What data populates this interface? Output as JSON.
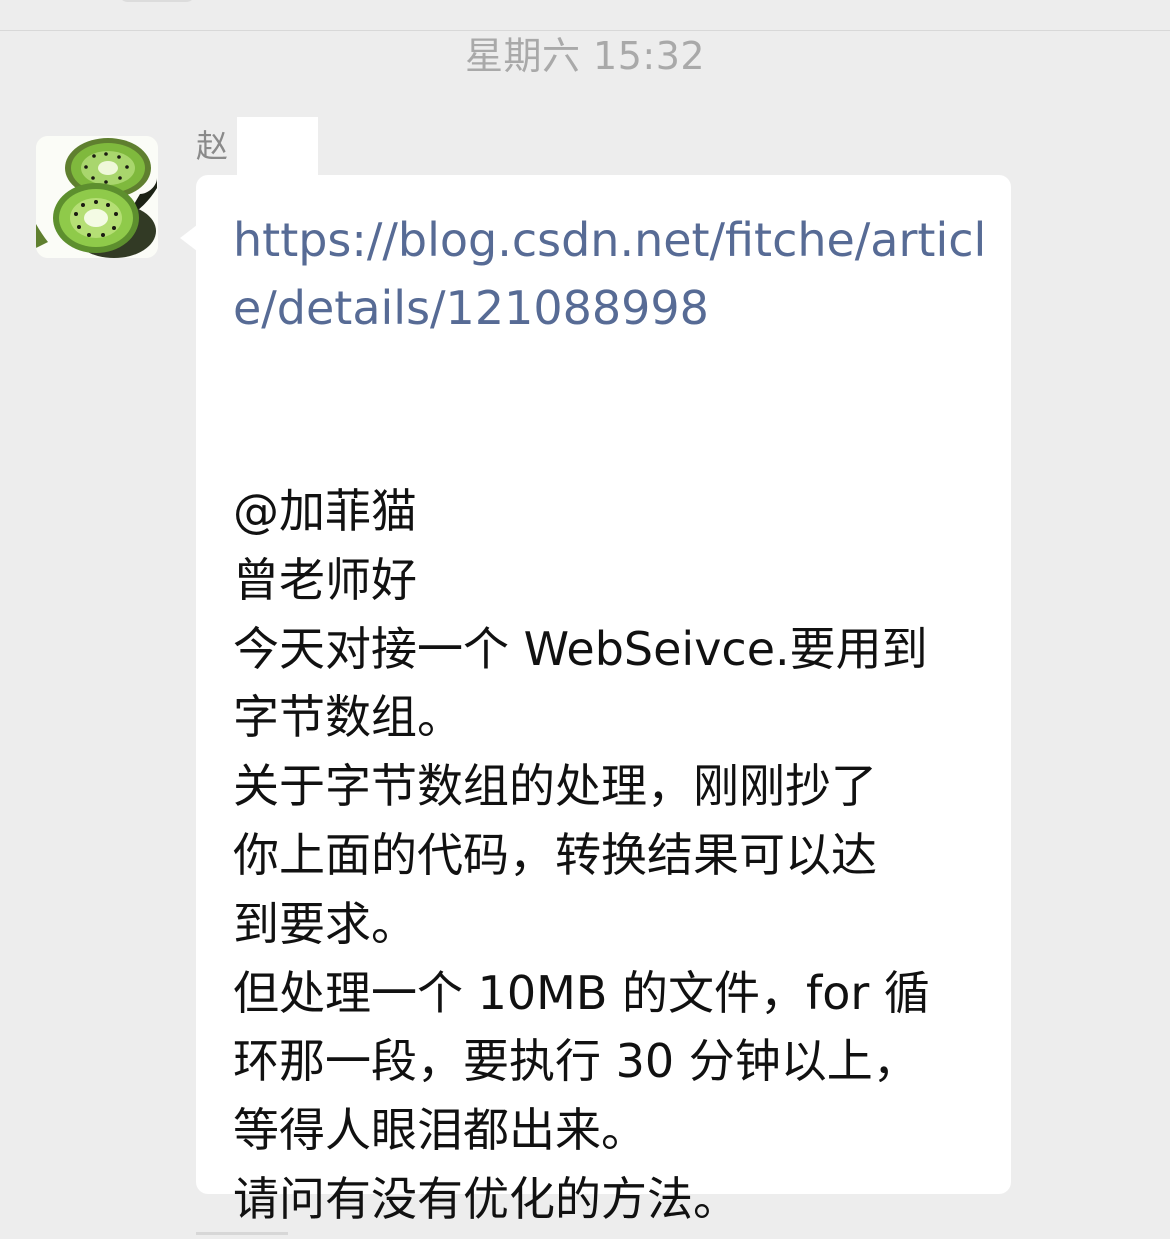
{
  "timestamp": "星期六 15:32",
  "sender": {
    "name": "赵"
  },
  "message": {
    "link_lines": [
      "https://blog.csdn.net/fitche/articl",
      "e/details/121088998"
    ],
    "text_lines": [
      "@加菲猫",
      "曾老师好",
      "今天对接一个 WebSeivce.要用到",
      "字节数组。",
      "关于字节数组的处理，刚刚抄了",
      "你上面的代码，转换结果可以达",
      "到要求。",
      "但处理一个 10MB 的文件，for 循",
      "环那一段，要执行 30 分钟以上，",
      "等得人眼泪都出来。",
      "请问有没有优化的方法。"
    ]
  },
  "colors": {
    "background": "#ededed",
    "bubble": "#ffffff",
    "link": "#576b95",
    "timestamp": "#a9a9a9",
    "sender": "#8a8a8a"
  },
  "icons": {
    "avatar": "kiwi-fruit-avatar"
  }
}
